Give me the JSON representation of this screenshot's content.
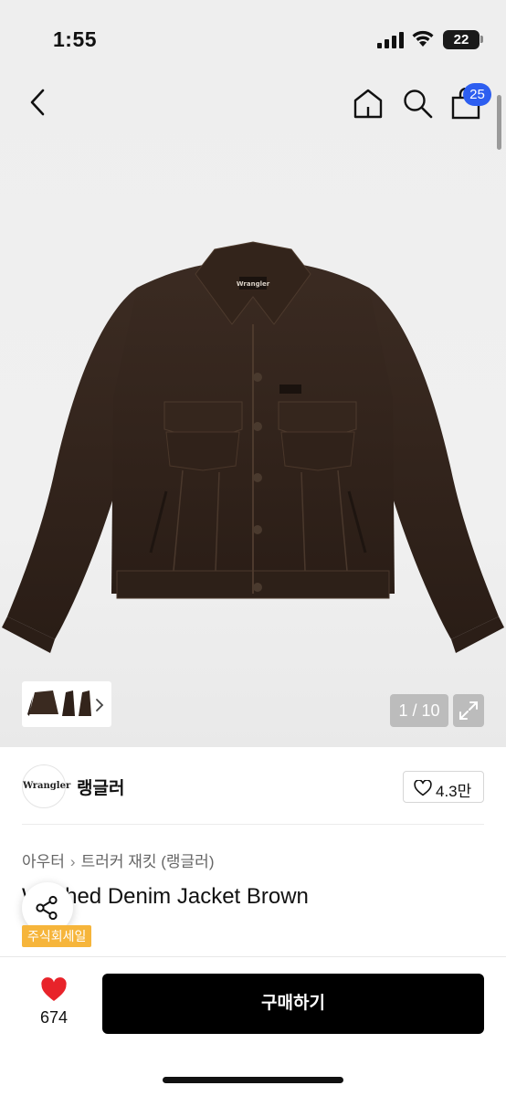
{
  "status_bar": {
    "time": "1:55",
    "battery": "22"
  },
  "nav": {
    "cart_badge": "25"
  },
  "gallery": {
    "pager": "1 / 10",
    "jacket_logo": "Wrangler"
  },
  "brand": {
    "logo_text": "Wrangler",
    "name": "랭글러",
    "like_count": "4.3만"
  },
  "breadcrumb": {
    "category": "아우터",
    "subcategory": "트러커 재킷 (랭글러)"
  },
  "product": {
    "title": "Washed Denim Jacket Brown",
    "sale_tag": "주식회세일"
  },
  "bottom_bar": {
    "wish_count": "674",
    "buy_label": "구매하기"
  },
  "colors": {
    "accent_badge": "#2d5ef0",
    "sale_tag": "#f6b53b",
    "heart": "#e8232a",
    "buy_button": "#000000"
  },
  "icons": [
    "signal-icon",
    "wifi-icon",
    "back-icon",
    "home-icon",
    "search-icon",
    "shopping-bag-icon",
    "chevron-right-icon",
    "expand-icon",
    "heart-outline-icon",
    "share-icon",
    "heart-filled-icon"
  ]
}
